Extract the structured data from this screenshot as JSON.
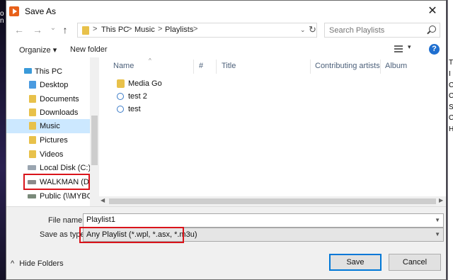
{
  "background": {
    "left_letters": [
      "o",
      "n"
    ],
    "right_letters": [
      "T",
      "I",
      "C",
      "C",
      "S",
      "C",
      "H"
    ]
  },
  "window": {
    "title": "Save As",
    "close_glyph": "✕"
  },
  "nav": {
    "back": "←",
    "forward": "→",
    "recent": "⌄",
    "up": "↑",
    "breadcrumb": [
      "This PC",
      "Music",
      "Playlists"
    ],
    "separator": ">",
    "refresh": "↻",
    "search_placeholder": "Search Playlists"
  },
  "toolbar": {
    "organize": "Organize ▾",
    "new_folder": "New folder",
    "view_caret": "▾",
    "help": "?"
  },
  "sidebar": {
    "items": [
      {
        "label": "This PC",
        "icon": "pc-icon"
      },
      {
        "label": "Desktop",
        "icon": "desktop-folder-icon"
      },
      {
        "label": "Documents",
        "icon": "documents-folder-icon"
      },
      {
        "label": "Downloads",
        "icon": "downloads-folder-icon"
      },
      {
        "label": "Music",
        "icon": "music-folder-icon"
      },
      {
        "label": "Pictures",
        "icon": "pictures-folder-icon"
      },
      {
        "label": "Videos",
        "icon": "videos-folder-icon"
      },
      {
        "label": "Local Disk (C:)",
        "icon": "local-disk-icon"
      },
      {
        "label": "WALKMAN (D:)",
        "icon": "drive-icon"
      },
      {
        "label": "Public (\\\\MYBOO",
        "icon": "network-drive-icon"
      }
    ]
  },
  "columns": {
    "name": "Name",
    "number": "#",
    "title": "Title",
    "artists": "Contributing artists",
    "album": "Album"
  },
  "files": [
    {
      "name": "Media Go",
      "type": "folder"
    },
    {
      "name": "test 2",
      "type": "playlist"
    },
    {
      "name": "test",
      "type": "playlist"
    }
  ],
  "form": {
    "filename_label": "File name:",
    "filename_value": "Playlist1",
    "type_label": "Save as type:",
    "type_value": "Any Playlist (*.wpl, *.asx, *.m3u)",
    "hide_folders": "Hide Folders",
    "hide_caret": "^",
    "save": "Save",
    "cancel": "Cancel"
  },
  "colors": {
    "highlight": "#d9141b",
    "selection": "#cce8ff",
    "accent": "#0078d7"
  }
}
